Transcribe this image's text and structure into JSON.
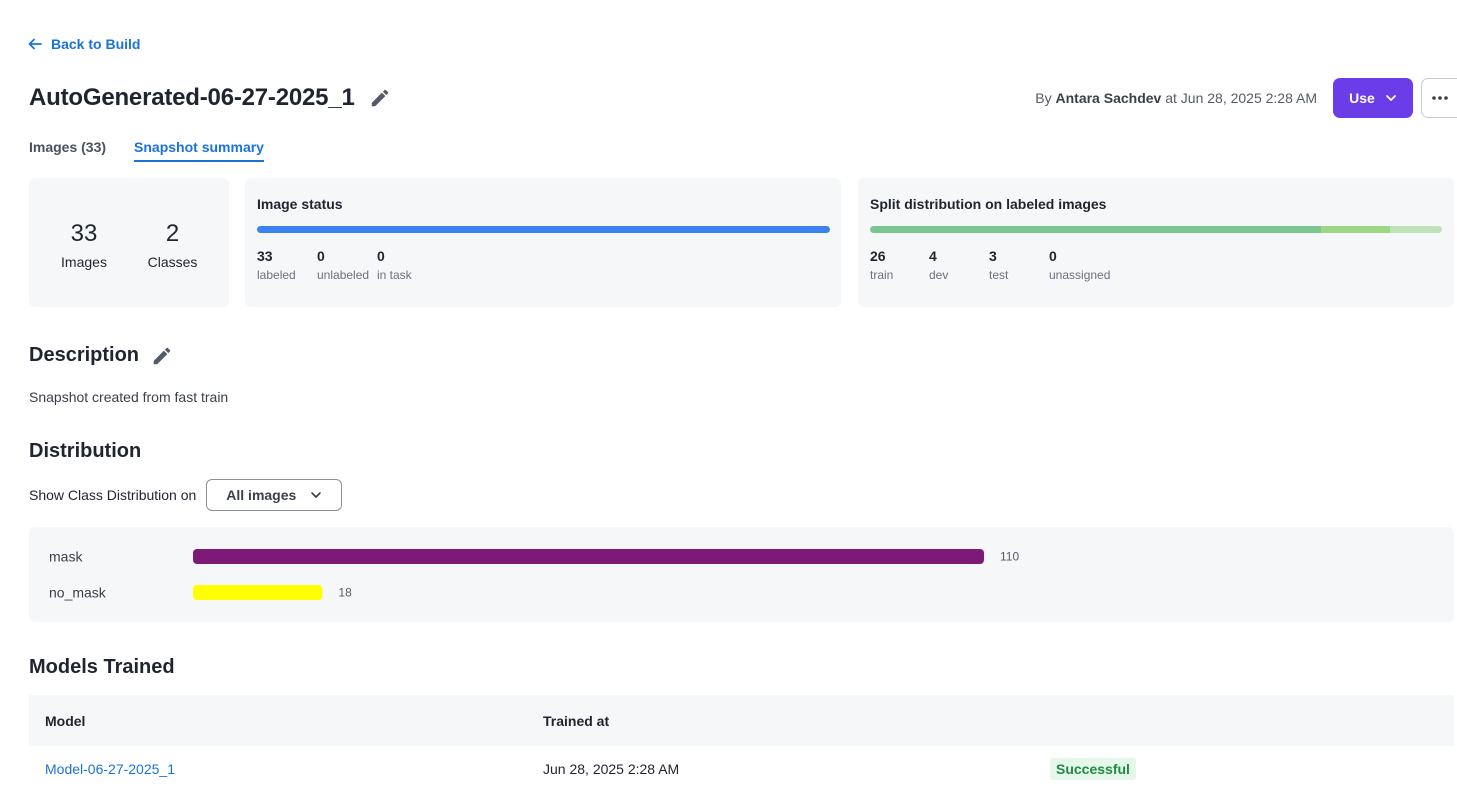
{
  "nav": {
    "back_label": "Back to Build"
  },
  "header": {
    "title": "AutoGenerated-06-27-2025_1",
    "byline_prefix": "By",
    "author": "Antara Sachdev",
    "byline_suffix": "at Jun 28, 2025 2:28 AM",
    "use_label": "Use"
  },
  "tabs": [
    {
      "label": "Images (33)"
    },
    {
      "label": "Snapshot summary"
    }
  ],
  "summary": {
    "images_count": "33",
    "images_label": "Images",
    "classes_count": "2",
    "classes_label": "Classes"
  },
  "image_status": {
    "title": "Image status",
    "stats": [
      {
        "value": "33",
        "label": "labeled"
      },
      {
        "value": "0",
        "label": "unlabeled"
      },
      {
        "value": "0",
        "label": "in task"
      }
    ],
    "colors": [
      "#3b82f0"
    ]
  },
  "split": {
    "title": "Split distribution on labeled images",
    "stats": [
      {
        "value": "26",
        "label": "train"
      },
      {
        "value": "4",
        "label": "dev"
      },
      {
        "value": "3",
        "label": "test"
      },
      {
        "value": "0",
        "label": "unassigned"
      }
    ],
    "colors": [
      "#7ac68f",
      "#9ed784",
      "#bfe3b9"
    ]
  },
  "description": {
    "title": "Description",
    "text": "Snapshot created from fast train"
  },
  "distribution": {
    "title": "Distribution",
    "show_label": "Show Class Distribution on",
    "selected": "All images"
  },
  "chart_data": {
    "type": "bar",
    "categories": [
      "mask",
      "no_mask"
    ],
    "values": [
      110,
      18
    ],
    "colors": [
      "#7d1a78",
      "#ffff00"
    ],
    "xlim": [
      0,
      110
    ]
  },
  "models": {
    "title": "Models Trained",
    "headers": [
      "Model",
      "Trained at"
    ],
    "rows": [
      {
        "model": "Model-06-27-2025_1",
        "trained_at": "Jun 28, 2025 2:28 AM",
        "status": "Successful"
      }
    ]
  }
}
